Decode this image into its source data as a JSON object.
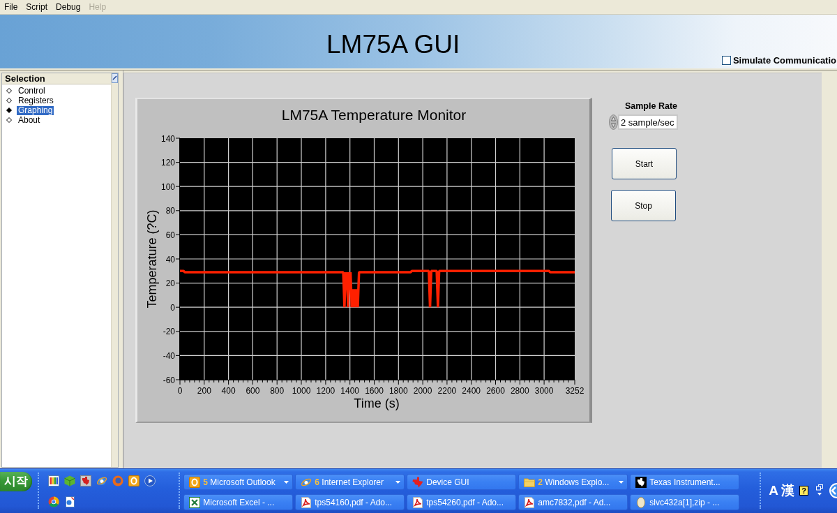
{
  "menu_bar": [
    {
      "label": "File",
      "disabled": false
    },
    {
      "label": "Script",
      "disabled": false
    },
    {
      "label": "Debug",
      "disabled": false
    },
    {
      "label": "Help",
      "disabled": true
    }
  ],
  "banner": {
    "title": "LM75A GUI",
    "simulate_checkbox": {
      "label": "Simulate Communicatio",
      "checked": false
    }
  },
  "sidebar": {
    "header": "Selection",
    "items": [
      {
        "label": "Control",
        "selected": false
      },
      {
        "label": "Registers",
        "selected": false
      },
      {
        "label": "Graphing",
        "selected": true
      },
      {
        "label": "About",
        "selected": false
      }
    ]
  },
  "chart_panel": {
    "chart_data": {
      "type": "line",
      "title": "LM75A Temperature Monitor",
      "xlabel": "Time (s)",
      "ylabel": "Temperature (?C)",
      "x": [
        0,
        30,
        40,
        1345,
        1350,
        1355,
        1360,
        1365,
        1370,
        1375,
        1380,
        1385,
        1390,
        1395,
        1400,
        1405,
        1410,
        1415,
        1420,
        1425,
        1430,
        1435,
        1440,
        1445,
        1450,
        1455,
        1460,
        1465,
        1470,
        1475,
        1480,
        1900,
        1910,
        2050,
        2055,
        2060,
        2065,
        2070,
        2115,
        2120,
        2125,
        2130,
        2135,
        3040,
        3050,
        3252
      ],
      "series": [
        {
          "color": "#ff2000",
          "values": [
            30,
            30,
            29,
            29,
            15,
            0,
            15,
            29,
            15,
            29,
            15,
            0,
            15,
            29,
            15,
            29,
            15,
            0,
            15,
            0,
            15,
            0,
            15,
            0,
            15,
            0,
            15,
            0,
            15,
            29,
            29,
            29,
            30,
            30,
            15,
            0,
            15,
            30,
            30,
            15,
            0,
            15,
            30,
            30,
            29,
            29
          ]
        }
      ],
      "xlim": [
        0,
        3252
      ],
      "ylim": [
        -60,
        140
      ],
      "xticks": [
        0,
        200,
        400,
        600,
        800,
        1000,
        1200,
        1400,
        1600,
        1800,
        2000,
        2200,
        2400,
        2600,
        2800,
        3000,
        3252
      ],
      "yticks": [
        -60,
        -40,
        -20,
        0,
        20,
        40,
        60,
        80,
        100,
        120,
        140
      ],
      "grid": true
    }
  },
  "sample_rate": {
    "label": "Sample Rate",
    "value": "2 sample/sec"
  },
  "buttons": [
    {
      "label": "Start"
    },
    {
      "label": "Stop"
    }
  ],
  "taskbar": {
    "start_button": "시작",
    "tasks": [
      {
        "count": "5",
        "label": "Microsoft Outlook",
        "grouped": true
      },
      {
        "count": "6",
        "label": "Internet Explorer",
        "grouped": true
      },
      {
        "label": "Device GUI",
        "grouped": false
      },
      {
        "count": "2",
        "label": "Windows Explo...",
        "grouped": true
      },
      {
        "label": "Texas Instrument...",
        "grouped": false
      },
      {
        "label": "Microsoft Excel - ...",
        "grouped": false
      },
      {
        "label": "tps54160,pdf - Ado...",
        "grouped": false
      },
      {
        "label": "tps54260,pdf - Ado...",
        "grouped": false
      },
      {
        "label": "amc7832,pdf - Ad...",
        "grouped": false
      },
      {
        "label": "slvc432a[1],zip - ...",
        "grouped": false
      }
    ],
    "tray": {
      "ime": [
        "A",
        "漢"
      ],
      "help": "?"
    }
  }
}
